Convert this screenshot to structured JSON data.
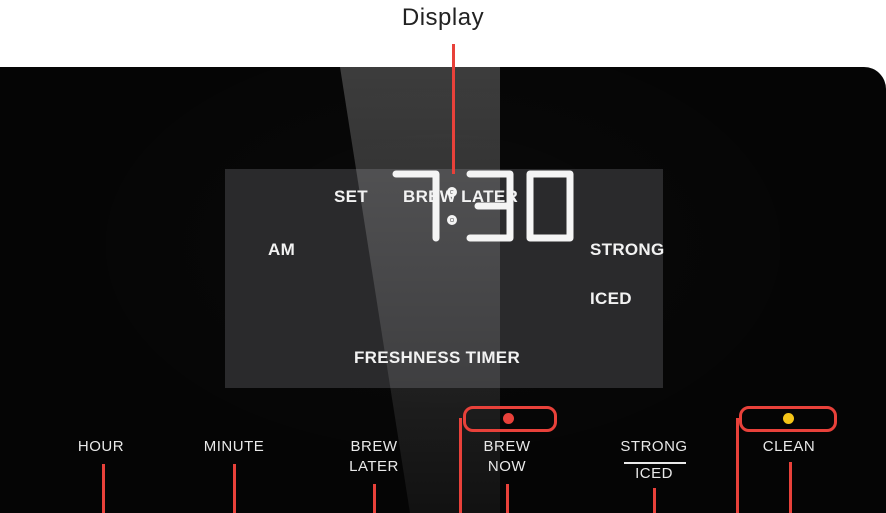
{
  "callout": {
    "label": "Display"
  },
  "display": {
    "set": "SET",
    "brew_later": "BREW LATER",
    "am": "AM",
    "time": "7:30",
    "strong": "STRONG",
    "iced": "ICED",
    "freshness_timer": "FRESHNESS TIMER"
  },
  "buttons": {
    "hour": "HOUR",
    "minute": "MINUTE",
    "brew_later_line1": "BREW",
    "brew_later_line2": "LATER",
    "brew_now_line1": "BREW",
    "brew_now_line2": "NOW",
    "strong": "STRONG",
    "iced": "ICED",
    "clean": "CLEAN"
  },
  "colors": {
    "callout": "#e8413a",
    "brew_now_indicator": "#e8413a",
    "clean_indicator": "#f5c518",
    "panel": "#050505",
    "lcd": "#2a2a2c"
  }
}
